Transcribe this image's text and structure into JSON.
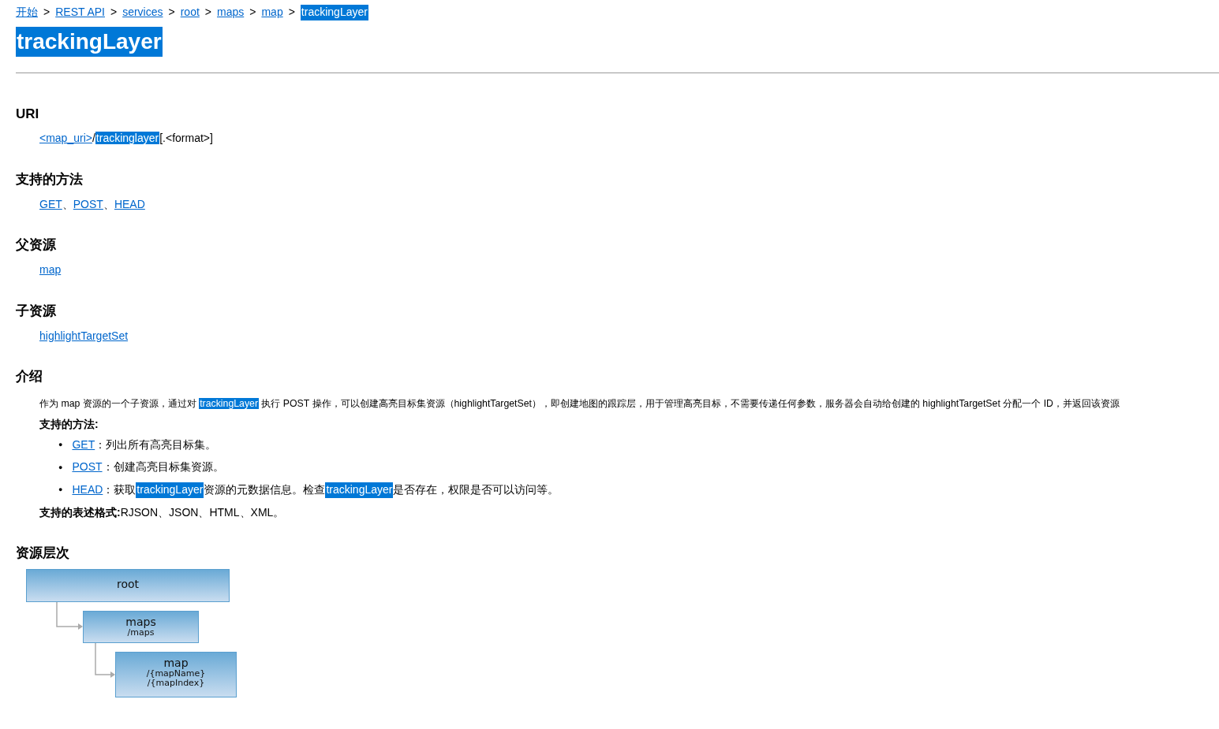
{
  "breadcrumb": [
    {
      "text": "开始",
      "kind": "link"
    },
    {
      "text": "REST API",
      "kind": "link"
    },
    {
      "text": "services",
      "kind": "link"
    },
    {
      "text": "root",
      "kind": "link"
    },
    {
      "text": "maps",
      "kind": "link"
    },
    {
      "text": "map",
      "kind": "link"
    },
    {
      "text": "trackingLayer",
      "kind": "highlight"
    }
  ],
  "breadcrumb_separator": ">",
  "title": "trackingLayer",
  "sections": [
    {
      "heading": "URI",
      "kind": "uri",
      "segments": [
        {
          "text": "<map_uri>",
          "kind": "link"
        },
        {
          "text": "/",
          "kind": "plain"
        },
        {
          "text": "trackinglayer",
          "kind": "highlight"
        },
        {
          "text": "[.<format>]",
          "kind": "plain"
        }
      ]
    },
    {
      "heading": "支持的方法",
      "kind": "links",
      "links": [
        "GET",
        "POST",
        "HEAD"
      ],
      "separator": "、"
    },
    {
      "heading": "父资源",
      "kind": "links",
      "links": [
        "map"
      ]
    },
    {
      "heading": "子资源",
      "kind": "links",
      "links": [
        "highlightTargetSet"
      ]
    },
    {
      "heading": "介绍",
      "kind": "intro",
      "paragraph": [
        {
          "text": "作为 map 资源的一个子资源，通过对 ",
          "kind": "plain"
        },
        {
          "text": "trackingLayer",
          "kind": "highlight"
        },
        {
          "text": " 执行 POST 操作，可以创建高亮目标集资源（highlightTargetSet），即创建地图的跟踪层，用于管理高亮目标，不需要传递任何参数，服务器会自动给创建的 highlightTargetSet 分配一个 ID，并返回该资源",
          "kind": "plain"
        }
      ],
      "methods_label": "支持的方法:",
      "bullet": "●",
      "methods": [
        [
          {
            "text": "GET",
            "kind": "link"
          },
          {
            "text": "：列出所有高亮目标集。",
            "kind": "plain"
          }
        ],
        [
          {
            "text": "POST",
            "kind": "link"
          },
          {
            "text": "：创建高亮目标集资源。",
            "kind": "plain"
          }
        ],
        [
          {
            "text": "HEAD",
            "kind": "link"
          },
          {
            "text": "：获取 ",
            "kind": "plain"
          },
          {
            "text": "trackingLayer",
            "kind": "highlight"
          },
          {
            "text": " 资源的元数据信息。检查 ",
            "kind": "plain"
          },
          {
            "text": "trackingLayer",
            "kind": "highlight"
          },
          {
            "text": " 是否存在，权限是否可以访问等。",
            "kind": "plain"
          }
        ]
      ],
      "formats_label": "支持的表述格式:",
      "formats": "RJSON、JSON、HTML、XML。"
    },
    {
      "heading": "资源层次",
      "kind": "tree",
      "tree": [
        {
          "name": "root",
          "children": [
            {
              "name": "maps",
              "paths": [
                "/maps"
              ],
              "children": [
                {
                  "name": "map",
                  "paths": [
                    "/{mapName}",
                    "/{mapIndex}"
                  ]
                }
              ]
            }
          ]
        }
      ]
    }
  ]
}
